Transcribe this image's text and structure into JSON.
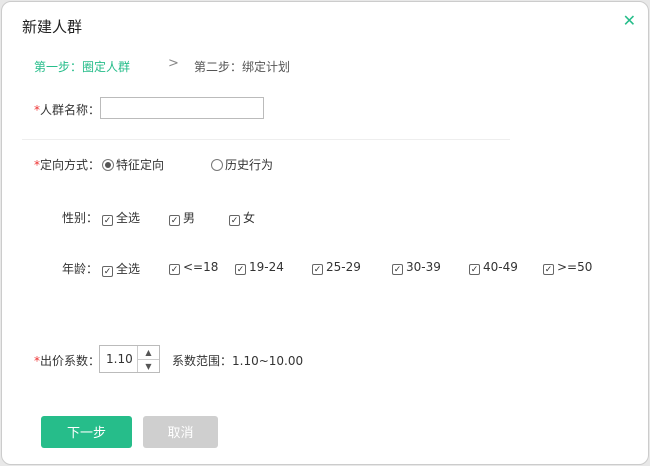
{
  "dialog": {
    "title": "新建人群",
    "close_icon": "close-icon"
  },
  "steps": {
    "step1": "第一步：圈定人群",
    "step2": "第二步：绑定计划",
    "active_color": "#26bd8a"
  },
  "name_field": {
    "label": "人群名称：",
    "value": ""
  },
  "targeting": {
    "label": "定向方式：",
    "options": [
      {
        "label": "特征定向",
        "selected": true
      },
      {
        "label": "历史行为",
        "selected": false
      }
    ]
  },
  "gender": {
    "label": "性别：",
    "options": [
      {
        "label": "全选",
        "checked": true
      },
      {
        "label": "男",
        "checked": true
      },
      {
        "label": "女",
        "checked": true
      }
    ]
  },
  "age": {
    "label": "年龄：",
    "options": [
      {
        "label": "全选",
        "checked": true
      },
      {
        "label": "<=18",
        "checked": true
      },
      {
        "label": "19-24",
        "checked": true
      },
      {
        "label": "25-29",
        "checked": true
      },
      {
        "label": "30-39",
        "checked": true
      },
      {
        "label": "40-49",
        "checked": true
      },
      {
        "label": ">=50",
        "checked": true
      }
    ]
  },
  "bid": {
    "label": "出价系数：",
    "value": "1.10",
    "range": "系数范围：1.10~10.00"
  },
  "buttons": {
    "next": "下一步",
    "cancel": "取消"
  }
}
